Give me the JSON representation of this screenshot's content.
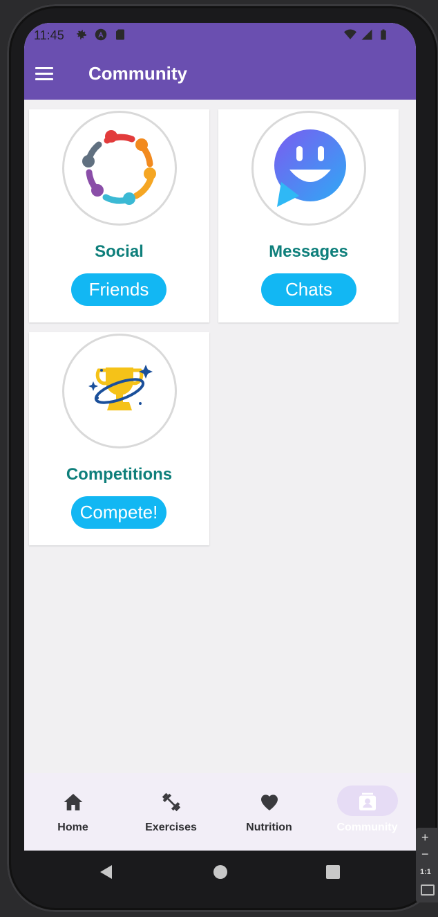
{
  "status_bar": {
    "time": "11:45",
    "left_icons": [
      "gear-icon",
      "app-a-icon",
      "sd-card-icon"
    ],
    "right_icons": [
      "wifi-icon",
      "signal-icon",
      "battery-icon"
    ]
  },
  "app_bar": {
    "title": "Community",
    "menu_icon": "hamburger-menu-icon",
    "color": "#6a4fb0"
  },
  "cards": [
    {
      "title": "Social",
      "button": "Friends",
      "icon": "people-circle-icon"
    },
    {
      "title": "Messages",
      "button": "Chats",
      "icon": "smiling-chat-bubble-icon"
    },
    {
      "title": "Competitions",
      "button": "Compete!",
      "icon": "trophy-icon"
    }
  ],
  "bottom_nav": {
    "items": [
      {
        "label": "Home",
        "icon": "home-icon",
        "active": false
      },
      {
        "label": "Exercises",
        "icon": "dumbbell-icon",
        "active": false
      },
      {
        "label": "Nutrition",
        "icon": "heart-icon",
        "active": false
      },
      {
        "label": "Community",
        "icon": "contact-card-icon",
        "active": true
      }
    ]
  },
  "system_nav": {
    "buttons": [
      "back-icon",
      "home-circle-icon",
      "recents-square-icon"
    ]
  },
  "emulator_tools": {
    "zoom_label": "1:1"
  },
  "colors": {
    "accent": "#6a4fb0",
    "title_teal": "#0e7f7b",
    "button_blue": "#12b7f3",
    "background": "#f1f0f2"
  }
}
